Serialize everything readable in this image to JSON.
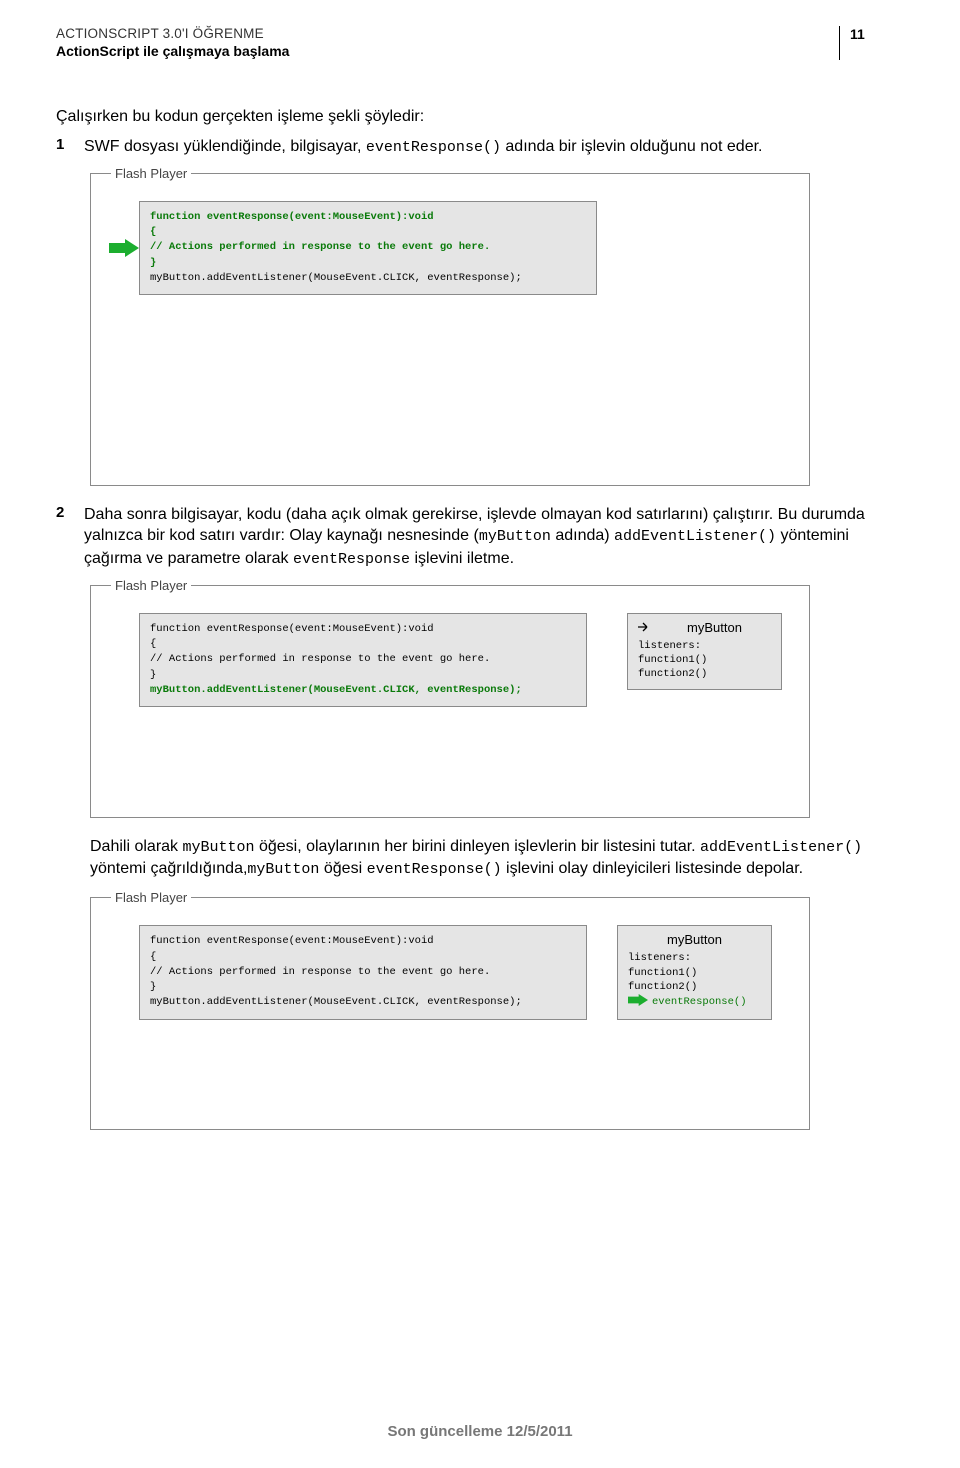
{
  "header": {
    "title": "ACTIONSCRIPT 3.0'I ÖĞRENME",
    "subtitle": "ActionScript ile çalışmaya başlama",
    "page_number": "11"
  },
  "intro": "Çalışırken bu kodun gerçekten işleme şekli şöyledir:",
  "steps": {
    "s1_num": "1",
    "s1_a": "SWF dosyası yüklendiğinde, bilgisayar, ",
    "s1_code": "eventResponse()",
    "s1_b": " adında bir işlevin olduğunu not eder.",
    "s2_num": "2",
    "s2_a": "Daha sonra bilgisayar, kodu (daha açık olmak gerekirse, işlevde olmayan kod satırlarını) çalıştırır. Bu durumda yalnızca bir kod satırı vardır: Olay kaynağı nesnesinde (",
    "s2_code1": "myButton",
    "s2_b": " adında) ",
    "s2_code2": "addEventListener()",
    "s2_c": " yöntemini çağırma ve parametre olarak ",
    "s2_code3": "eventResponse",
    "s2_d": " işlevini iletme."
  },
  "diagram_legend": "Flash Player",
  "code_block": {
    "l1": "function eventResponse(event:MouseEvent):void",
    "l2": "{",
    "l3": "  // Actions performed in response to the event go here.",
    "l4": "}",
    "l5": "myButton.addEventListener(MouseEvent.CLICK, eventResponse);"
  },
  "obj": {
    "title": "myButton",
    "listeners_label": "listeners:",
    "fn1": "function1()",
    "fn2": "function2()",
    "fn3": "eventResponse()"
  },
  "para3": {
    "a": "Dahili olarak ",
    "c1": "myButton",
    "b": " öğesi, olaylarının her birini dinleyen işlevlerin bir listesini tutar. ",
    "c2": "addEventListener()",
    "c": " yöntemi çağrıldığında,",
    "c3": "myButton",
    "d": " öğesi ",
    "c4": "eventResponse()",
    "e": " işlevini olay dinleyicileri listesinde depolar."
  },
  "footer": "Son güncelleme 12/5/2011"
}
